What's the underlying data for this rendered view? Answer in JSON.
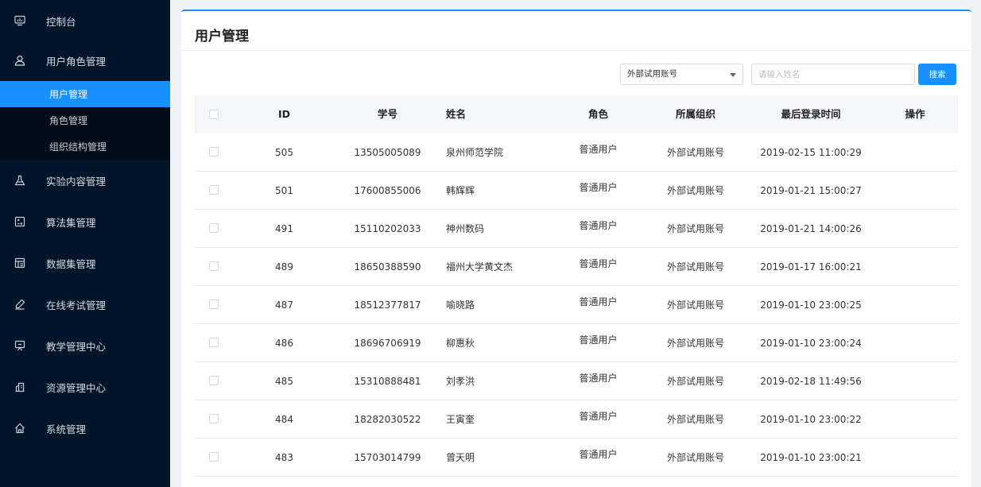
{
  "sidebar": {
    "items": [
      {
        "label": "控制台",
        "icon": "monitor-icon"
      },
      {
        "label": "用户角色管理",
        "icon": "user-icon"
      },
      {
        "label": "实验内容管理",
        "icon": "flask-icon"
      },
      {
        "label": "算法集管理",
        "icon": "algorithm-icon"
      },
      {
        "label": "数据集管理",
        "icon": "dataset-icon"
      },
      {
        "label": "在线考试管理",
        "icon": "exam-icon"
      },
      {
        "label": "教学管理中心",
        "icon": "teaching-icon"
      },
      {
        "label": "资源管理中心",
        "icon": "resource-icon"
      },
      {
        "label": "系统管理",
        "icon": "home-icon"
      }
    ],
    "submenu": [
      {
        "label": "用户管理",
        "active": true
      },
      {
        "label": "角色管理",
        "active": false
      },
      {
        "label": "组织结构管理",
        "active": false
      }
    ]
  },
  "page": {
    "title": "用户管理"
  },
  "toolbar": {
    "org_select_value": "外部试用账号",
    "search_placeholder": "请输入姓名",
    "search_label": "搜索"
  },
  "table": {
    "headers": {
      "id": "ID",
      "sid": "学号",
      "name": "姓名",
      "role": "角色",
      "org": "所属组织",
      "time": "最后登录时间",
      "op": "操作"
    },
    "rows": [
      {
        "id": "505",
        "sid": "13505005089",
        "name": "泉州师范学院",
        "role": "普通用户",
        "org": "外部试用账号",
        "time": "2019-02-15 11:00:29"
      },
      {
        "id": "501",
        "sid": "17600855006",
        "name": "韩辉辉",
        "role": "普通用户",
        "org": "外部试用账号",
        "time": "2019-01-21 15:00:27"
      },
      {
        "id": "491",
        "sid": "15110202033",
        "name": "神州数码",
        "role": "普通用户",
        "org": "外部试用账号",
        "time": "2019-01-21 14:00:26"
      },
      {
        "id": "489",
        "sid": "18650388590",
        "name": "福州大学黄文杰",
        "role": "普通用户",
        "org": "外部试用账号",
        "time": "2019-01-17 16:00:21"
      },
      {
        "id": "487",
        "sid": "18512377817",
        "name": "喻晓路",
        "role": "普通用户",
        "org": "外部试用账号",
        "time": "2019-01-10 23:00:25"
      },
      {
        "id": "486",
        "sid": "18696706919",
        "name": "柳惠秋",
        "role": "普通用户",
        "org": "外部试用账号",
        "time": "2019-01-10 23:00:24"
      },
      {
        "id": "485",
        "sid": "15310888481",
        "name": "刘孝洪",
        "role": "普通用户",
        "org": "外部试用账号",
        "time": "2019-02-18 11:49:56"
      },
      {
        "id": "484",
        "sid": "18282030522",
        "name": "王寅奎",
        "role": "普通用户",
        "org": "外部试用账号",
        "time": "2019-01-10 23:00:22"
      },
      {
        "id": "483",
        "sid": "15703014799",
        "name": "曾天明",
        "role": "普通用户",
        "org": "外部试用账号",
        "time": "2019-01-10 23:00:21"
      }
    ]
  },
  "colors": {
    "sidebar_bg": "#001529",
    "submenu_bg": "#000c17",
    "accent": "#1890ff"
  }
}
